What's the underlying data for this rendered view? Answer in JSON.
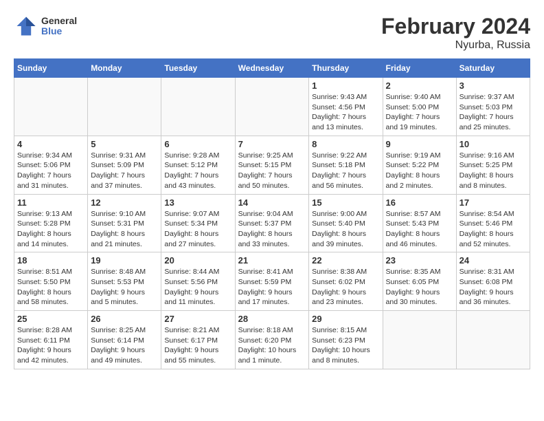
{
  "header": {
    "logo": {
      "general": "General",
      "blue": "Blue"
    },
    "title": "February 2024",
    "location": "Nyurba, Russia"
  },
  "weekdays": [
    "Sunday",
    "Monday",
    "Tuesday",
    "Wednesday",
    "Thursday",
    "Friday",
    "Saturday"
  ],
  "weeks": [
    [
      {
        "day": "",
        "info": ""
      },
      {
        "day": "",
        "info": ""
      },
      {
        "day": "",
        "info": ""
      },
      {
        "day": "",
        "info": ""
      },
      {
        "day": "1",
        "info": "Sunrise: 9:43 AM\nSunset: 4:56 PM\nDaylight: 7 hours\nand 13 minutes."
      },
      {
        "day": "2",
        "info": "Sunrise: 9:40 AM\nSunset: 5:00 PM\nDaylight: 7 hours\nand 19 minutes."
      },
      {
        "day": "3",
        "info": "Sunrise: 9:37 AM\nSunset: 5:03 PM\nDaylight: 7 hours\nand 25 minutes."
      }
    ],
    [
      {
        "day": "4",
        "info": "Sunrise: 9:34 AM\nSunset: 5:06 PM\nDaylight: 7 hours\nand 31 minutes."
      },
      {
        "day": "5",
        "info": "Sunrise: 9:31 AM\nSunset: 5:09 PM\nDaylight: 7 hours\nand 37 minutes."
      },
      {
        "day": "6",
        "info": "Sunrise: 9:28 AM\nSunset: 5:12 PM\nDaylight: 7 hours\nand 43 minutes."
      },
      {
        "day": "7",
        "info": "Sunrise: 9:25 AM\nSunset: 5:15 PM\nDaylight: 7 hours\nand 50 minutes."
      },
      {
        "day": "8",
        "info": "Sunrise: 9:22 AM\nSunset: 5:18 PM\nDaylight: 7 hours\nand 56 minutes."
      },
      {
        "day": "9",
        "info": "Sunrise: 9:19 AM\nSunset: 5:22 PM\nDaylight: 8 hours\nand 2 minutes."
      },
      {
        "day": "10",
        "info": "Sunrise: 9:16 AM\nSunset: 5:25 PM\nDaylight: 8 hours\nand 8 minutes."
      }
    ],
    [
      {
        "day": "11",
        "info": "Sunrise: 9:13 AM\nSunset: 5:28 PM\nDaylight: 8 hours\nand 14 minutes."
      },
      {
        "day": "12",
        "info": "Sunrise: 9:10 AM\nSunset: 5:31 PM\nDaylight: 8 hours\nand 21 minutes."
      },
      {
        "day": "13",
        "info": "Sunrise: 9:07 AM\nSunset: 5:34 PM\nDaylight: 8 hours\nand 27 minutes."
      },
      {
        "day": "14",
        "info": "Sunrise: 9:04 AM\nSunset: 5:37 PM\nDaylight: 8 hours\nand 33 minutes."
      },
      {
        "day": "15",
        "info": "Sunrise: 9:00 AM\nSunset: 5:40 PM\nDaylight: 8 hours\nand 39 minutes."
      },
      {
        "day": "16",
        "info": "Sunrise: 8:57 AM\nSunset: 5:43 PM\nDaylight: 8 hours\nand 46 minutes."
      },
      {
        "day": "17",
        "info": "Sunrise: 8:54 AM\nSunset: 5:46 PM\nDaylight: 8 hours\nand 52 minutes."
      }
    ],
    [
      {
        "day": "18",
        "info": "Sunrise: 8:51 AM\nSunset: 5:50 PM\nDaylight: 8 hours\nand 58 minutes."
      },
      {
        "day": "19",
        "info": "Sunrise: 8:48 AM\nSunset: 5:53 PM\nDaylight: 9 hours\nand 5 minutes."
      },
      {
        "day": "20",
        "info": "Sunrise: 8:44 AM\nSunset: 5:56 PM\nDaylight: 9 hours\nand 11 minutes."
      },
      {
        "day": "21",
        "info": "Sunrise: 8:41 AM\nSunset: 5:59 PM\nDaylight: 9 hours\nand 17 minutes."
      },
      {
        "day": "22",
        "info": "Sunrise: 8:38 AM\nSunset: 6:02 PM\nDaylight: 9 hours\nand 23 minutes."
      },
      {
        "day": "23",
        "info": "Sunrise: 8:35 AM\nSunset: 6:05 PM\nDaylight: 9 hours\nand 30 minutes."
      },
      {
        "day": "24",
        "info": "Sunrise: 8:31 AM\nSunset: 6:08 PM\nDaylight: 9 hours\nand 36 minutes."
      }
    ],
    [
      {
        "day": "25",
        "info": "Sunrise: 8:28 AM\nSunset: 6:11 PM\nDaylight: 9 hours\nand 42 minutes."
      },
      {
        "day": "26",
        "info": "Sunrise: 8:25 AM\nSunset: 6:14 PM\nDaylight: 9 hours\nand 49 minutes."
      },
      {
        "day": "27",
        "info": "Sunrise: 8:21 AM\nSunset: 6:17 PM\nDaylight: 9 hours\nand 55 minutes."
      },
      {
        "day": "28",
        "info": "Sunrise: 8:18 AM\nSunset: 6:20 PM\nDaylight: 10 hours\nand 1 minute."
      },
      {
        "day": "29",
        "info": "Sunrise: 8:15 AM\nSunset: 6:23 PM\nDaylight: 10 hours\nand 8 minutes."
      },
      {
        "day": "",
        "info": ""
      },
      {
        "day": "",
        "info": ""
      }
    ]
  ]
}
